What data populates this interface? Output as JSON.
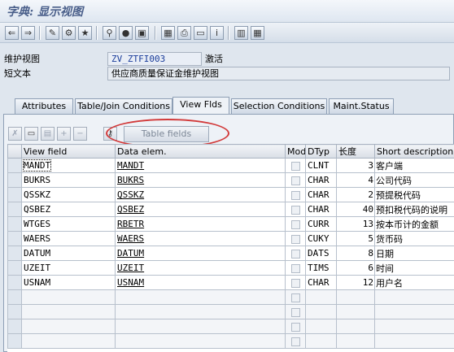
{
  "window": {
    "title": "字典: 显示视图"
  },
  "toolbar": {
    "icons": [
      "back-arrow-icon",
      "forward-arrow-icon",
      "other-object-icon",
      "display-change-icon",
      "activate-icon",
      "where-used-icon",
      "object-list-icon",
      "navigation-window-icon",
      "hierarchy-icon",
      "print-icon",
      "display-object-icon",
      "info-icon",
      "technical-settings-icon",
      "table-contents-icon"
    ]
  },
  "form": {
    "view_label": "维护视图",
    "view_name": "ZV_ZTFI003",
    "view_status": "激活",
    "short_text_label": "短文本",
    "short_text": "供应商质量保证金维护视图"
  },
  "tabs": [
    {
      "label": "Attributes"
    },
    {
      "label": "Table/Join Conditions"
    },
    {
      "label": "View Flds",
      "active": true
    },
    {
      "label": "Selection Conditions"
    },
    {
      "label": "Maint.Status"
    }
  ],
  "panel_toolbar": {
    "table_fields_label": "Table fields"
  },
  "grid": {
    "headers": {
      "view_field": "View field",
      "data_elem": "Data elem.",
      "mod": "Mod",
      "dtyp": "DTyp",
      "length": "长度",
      "short_desc": "Short description"
    },
    "rows": [
      {
        "view_field": "MANDT",
        "data_elem": "MANDT",
        "dtyp": "CLNT",
        "length": "3",
        "desc": "客户端"
      },
      {
        "view_field": "BUKRS",
        "data_elem": "BUKRS",
        "dtyp": "CHAR",
        "length": "4",
        "desc": "公司代码"
      },
      {
        "view_field": "QSSKZ",
        "data_elem": "QSSKZ",
        "dtyp": "CHAR",
        "length": "2",
        "desc": "预提税代码"
      },
      {
        "view_field": "QSBEZ",
        "data_elem": "QSBEZ",
        "dtyp": "CHAR",
        "length": "40",
        "desc": "预扣税代码的说明"
      },
      {
        "view_field": "WTGES",
        "data_elem": "RBETR",
        "dtyp": "CURR",
        "length": "13",
        "desc": "按本币计的金额"
      },
      {
        "view_field": "WAERS",
        "data_elem": "WAERS",
        "dtyp": "CUKY",
        "length": "5",
        "desc": "货币码"
      },
      {
        "view_field": "DATUM",
        "data_elem": "DATUM",
        "dtyp": "DATS",
        "length": "8",
        "desc": "日期"
      },
      {
        "view_field": "UZEIT",
        "data_elem": "UZEIT",
        "dtyp": "TIMS",
        "length": "6",
        "desc": "时间"
      },
      {
        "view_field": "USNAM",
        "data_elem": "USNAM",
        "dtyp": "CHAR",
        "length": "12",
        "desc": "用户名"
      }
    ]
  },
  "colors": {
    "annotation": "#d23a3a",
    "title": "#4a5f8a"
  }
}
